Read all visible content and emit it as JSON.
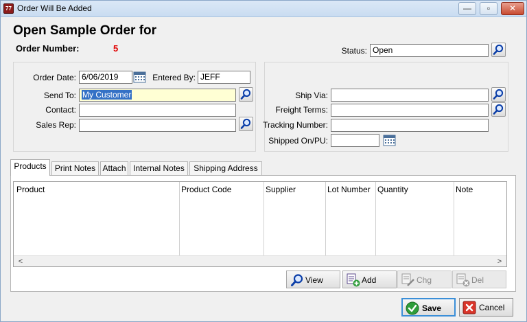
{
  "window": {
    "title": "Order Will Be Added",
    "minimize_glyph": "—",
    "maximize_glyph": "▫",
    "close_glyph": "✕",
    "icon_text": "77"
  },
  "header": {
    "headline": "Open Sample Order for",
    "order_number_label": "Order Number:",
    "order_number_value": "5",
    "status_label": "Status:",
    "status_value": "Open"
  },
  "left_panel": {
    "order_date_label": "Order Date:",
    "order_date_value": "6/06/2019",
    "entered_by_label": "Entered By:",
    "entered_by_value": "JEFF",
    "send_to_label": "Send To:",
    "send_to_value": "My Customer",
    "contact_label": "Contact:",
    "contact_value": "",
    "sales_rep_label": "Sales Rep:",
    "sales_rep_value": ""
  },
  "right_panel": {
    "ship_via_label": "Ship Via:",
    "ship_via_value": "",
    "freight_terms_label": "Freight Terms:",
    "freight_terms_value": "",
    "tracking_label": "Tracking Number:",
    "tracking_value": "",
    "shipped_label": "Shipped On/PU:",
    "shipped_value": ""
  },
  "tabs": [
    {
      "label": "Products"
    },
    {
      "label": "Print Notes"
    },
    {
      "label": "Attach"
    },
    {
      "label": "Internal Notes"
    },
    {
      "label": "Shipping Address"
    }
  ],
  "grid": {
    "columns": [
      "Product",
      "Product Code",
      "Supplier",
      "Lot Number",
      "Quantity",
      "Note"
    ],
    "rows": [],
    "scroll_left": "<",
    "scroll_right": ">"
  },
  "actions": {
    "view": "View",
    "add": "Add",
    "chg": "Chg",
    "del": "Del"
  },
  "footer": {
    "save": "Save",
    "cancel": "Cancel"
  },
  "colors": {
    "order_number": "#e00000",
    "selection": "#3471c6",
    "highlight_field": "#ffffd4"
  }
}
